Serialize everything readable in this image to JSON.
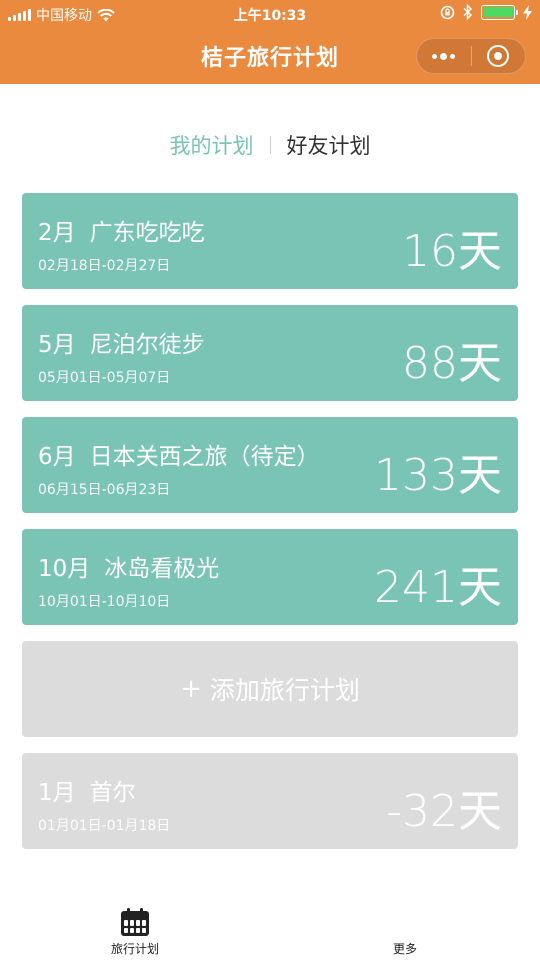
{
  "status_bar": {
    "carrier": "中国移动",
    "time": "上午10:33"
  },
  "nav": {
    "title": "桔子旅行计划"
  },
  "tabs": {
    "mine": "我的计划",
    "friends": "好友计划"
  },
  "plans": [
    {
      "month": "2月",
      "name": "广东吃吃吃",
      "range": "02月18日-02月27日",
      "days": "16天"
    },
    {
      "month": "5月",
      "name": "尼泊尔徒步",
      "range": "05月01日-05月07日",
      "days": "88天"
    },
    {
      "month": "6月",
      "name": "日本关西之旅（待定）",
      "range": "06月15日-06月23日",
      "days": "133天"
    },
    {
      "month": "10月",
      "name": "冰岛看极光",
      "range": "10月01日-10月10日",
      "days": "241天"
    }
  ],
  "add_plan": {
    "plus": "+",
    "label": "添加旅行计划"
  },
  "past_plan": {
    "month": "1月",
    "name": "首尔",
    "range": "01月01日-01月18日",
    "days": "-32天"
  },
  "tab_bar": {
    "plans_label": "旅行计划",
    "more_label": "更多"
  },
  "colors": {
    "brand_orange": "#ea8a3f",
    "teal": "#7ac4b6",
    "grey_card": "#dcdcdc"
  }
}
